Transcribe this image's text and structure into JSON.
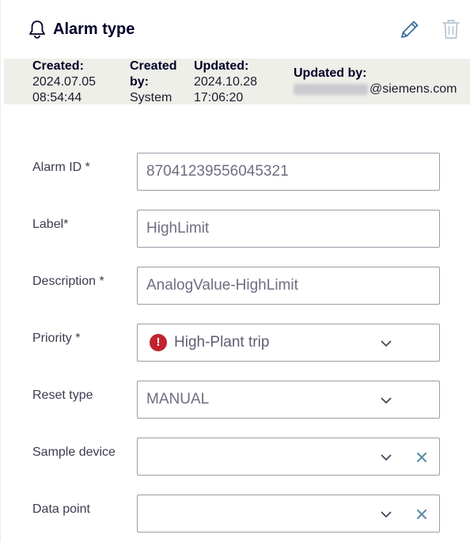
{
  "header": {
    "title": "Alarm type",
    "icons": {
      "bell": "bell-icon",
      "edit": "pencil-icon",
      "delete": "trash-icon"
    }
  },
  "meta": {
    "created_label": "Created:",
    "created_date": "2024.07.05",
    "created_time": "08:54:44",
    "created_by_label_1": "Created",
    "created_by_label_2": "by:",
    "created_by": "System",
    "updated_label": "Updated:",
    "updated_date": "2024.10.28",
    "updated_time": "17:06:20",
    "updated_by_label": "Updated by:",
    "updated_by_domain": "@siemens.com"
  },
  "fields": {
    "alarm_id": {
      "label": "Alarm ID *",
      "value": "87041239556045321"
    },
    "label": {
      "label": "Label*",
      "value": "HighLimit"
    },
    "description": {
      "label": "Description *",
      "value": "AnalogValue-HighLimit"
    },
    "priority": {
      "label": "Priority *",
      "value": "High-Plant trip",
      "icon": "!"
    },
    "reset_type": {
      "label": "Reset type",
      "value": "MANUAL"
    },
    "sample_device": {
      "label": "Sample device",
      "value": ""
    },
    "data_point": {
      "label": "Data point",
      "value": ""
    }
  },
  "colors": {
    "priority_high": "#c0232f",
    "clear_icon": "#5e8fa8",
    "meta_bg": "#efefe9"
  }
}
